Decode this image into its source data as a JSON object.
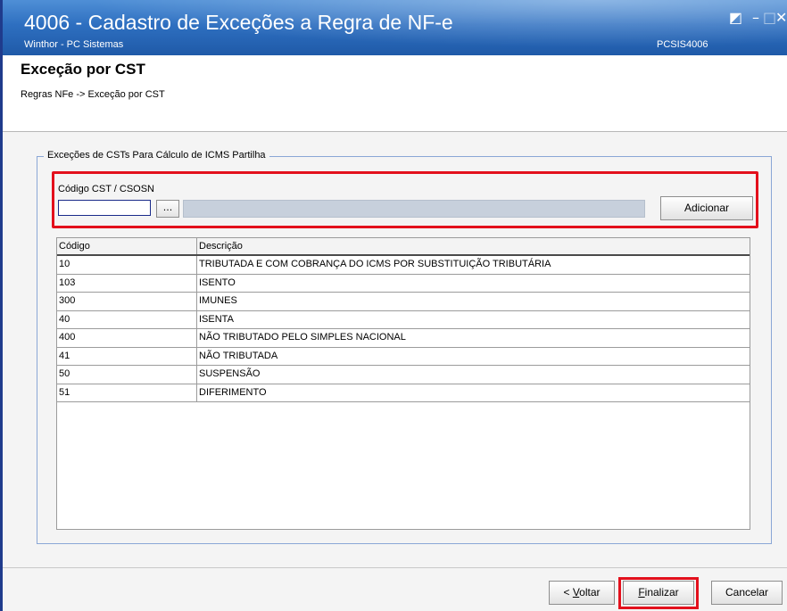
{
  "window": {
    "title": "4006 - Cadastro de Exceções a Regra de NF-e",
    "subtitle": "Winthor - PC Sistemas",
    "routine_code": "PCSIS4006",
    "controls": {
      "restore": "◩",
      "minimize": "–",
      "maximize": "□",
      "close": "✕"
    }
  },
  "header": {
    "title": "Exceção por CST",
    "breadcrumb": "Regras NFe -> Exceção por CST"
  },
  "group": {
    "legend": "Exceções de CSTs Para Cálculo de ICMS Partilha",
    "field_label": "Código CST / CSOSN",
    "code_value": "",
    "browse_label": "...",
    "add_label": "Adicionar"
  },
  "table": {
    "columns": [
      "Código",
      "Descrição"
    ],
    "rows": [
      {
        "code": "10",
        "desc": "TRIBUTADA E COM COBRANÇA DO ICMS POR SUBSTITUIÇÃO TRIBUTÁRIA"
      },
      {
        "code": "103",
        "desc": "ISENTO"
      },
      {
        "code": "300",
        "desc": "IMUNES"
      },
      {
        "code": "40",
        "desc": "ISENTA"
      },
      {
        "code": "400",
        "desc": "NÃO TRIBUTADO PELO SIMPLES NACIONAL"
      },
      {
        "code": "41",
        "desc": "NÃO TRIBUTADA"
      },
      {
        "code": "50",
        "desc": "SUSPENSÃO"
      },
      {
        "code": "51",
        "desc": "DIFERIMENTO"
      }
    ]
  },
  "footer": {
    "back_prefix": "< ",
    "back_mnemonic": "V",
    "back_rest": "oltar",
    "finish_mnemonic": "F",
    "finish_rest": "inalizar",
    "cancel_label": "Cancelar"
  },
  "colors": {
    "title_bar": "#2e6fc0",
    "highlight": "#e3101c",
    "fieldset_border": "#8aa7d6"
  }
}
